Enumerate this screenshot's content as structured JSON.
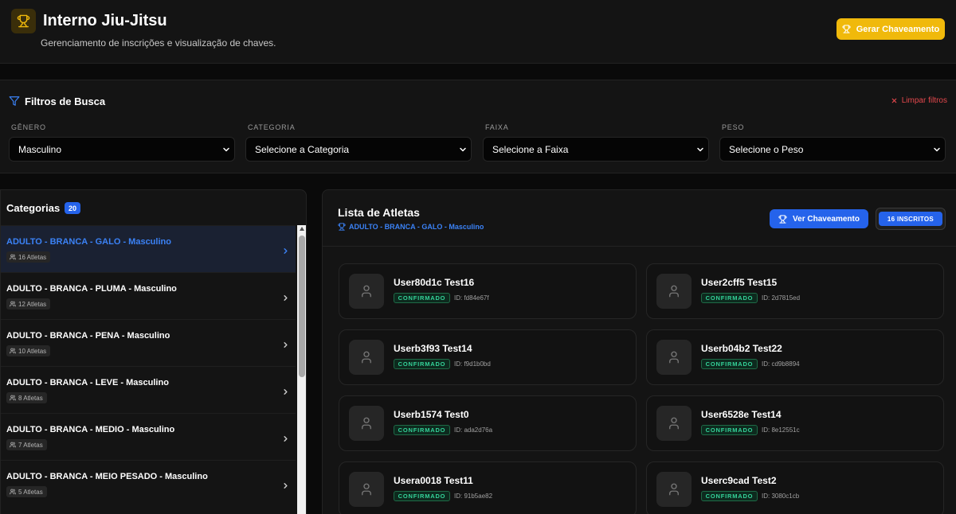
{
  "header": {
    "title": "Interno Jiu-Jitsu",
    "subtitle": "Gerenciamento de inscrições e visualização de chaves.",
    "generate_button": "Gerar Chaveamento"
  },
  "filters": {
    "title": "Filtros de Busca",
    "clear_label": "Limpar filtros",
    "fields": [
      {
        "label": "GÊNERO",
        "value": "Masculino"
      },
      {
        "label": "CATEGORIA",
        "value": "Selecione a Categoria"
      },
      {
        "label": "FAIXA",
        "value": "Selecione a Faixa"
      },
      {
        "label": "PESO",
        "value": "Selecione o Peso"
      }
    ]
  },
  "categories": {
    "title": "Categorias",
    "count": "20",
    "items": [
      {
        "name": "ADULTO - BRANCA - GALO - Masculino",
        "athletes": "16 Atletas",
        "active": true
      },
      {
        "name": "ADULTO - BRANCA - PLUMA - Masculino",
        "athletes": "12 Atletas"
      },
      {
        "name": "ADULTO - BRANCA - PENA - Masculino",
        "athletes": "10 Atletas"
      },
      {
        "name": "ADULTO - BRANCA - LEVE - Masculino",
        "athletes": "8 Atletas"
      },
      {
        "name": "ADULTO - BRANCA - MEDIO - Masculino",
        "athletes": "7 Atletas"
      },
      {
        "name": "ADULTO - BRANCA - MEIO PESADO - Masculino",
        "athletes": "5 Atletas"
      }
    ]
  },
  "athletes_panel": {
    "title": "Lista de Atletas",
    "subtitle": "ADULTO - BRANCA - GALO - Masculino",
    "view_button": "Ver Chaveamento",
    "enrolled_badge": "16 INSCRITOS",
    "athletes": [
      {
        "name": "User80d1c Test16",
        "status": "CONFIRMADO",
        "id": "ID: fd84e67f"
      },
      {
        "name": "User2cff5 Test15",
        "status": "CONFIRMADO",
        "id": "ID: 2d7815ed"
      },
      {
        "name": "Userb3f93 Test14",
        "status": "CONFIRMADO",
        "id": "ID: f9d1b0bd"
      },
      {
        "name": "Userb04b2 Test22",
        "status": "CONFIRMADO",
        "id": "ID: cd9b8894"
      },
      {
        "name": "Userb1574 Test0",
        "status": "CONFIRMADO",
        "id": "ID: ada2d76a"
      },
      {
        "name": "User6528e Test14",
        "status": "CONFIRMADO",
        "id": "ID: 8e12551c"
      },
      {
        "name": "Usera0018 Test11",
        "status": "CONFIRMADO",
        "id": "ID: 91b5ae82"
      },
      {
        "name": "Userc9cad Test2",
        "status": "CONFIRMADO",
        "id": "ID: 3080c1cb"
      }
    ]
  },
  "colors": {
    "accent_gold": "#f0b90b",
    "accent_blue": "#2563eb",
    "status_green": "#34d399",
    "danger_red": "#e5484d"
  },
  "icons": [
    "trophy-icon",
    "filter-icon",
    "close-icon",
    "chevron-down-icon",
    "users-icon",
    "chevron-right-icon",
    "user-icon"
  ]
}
